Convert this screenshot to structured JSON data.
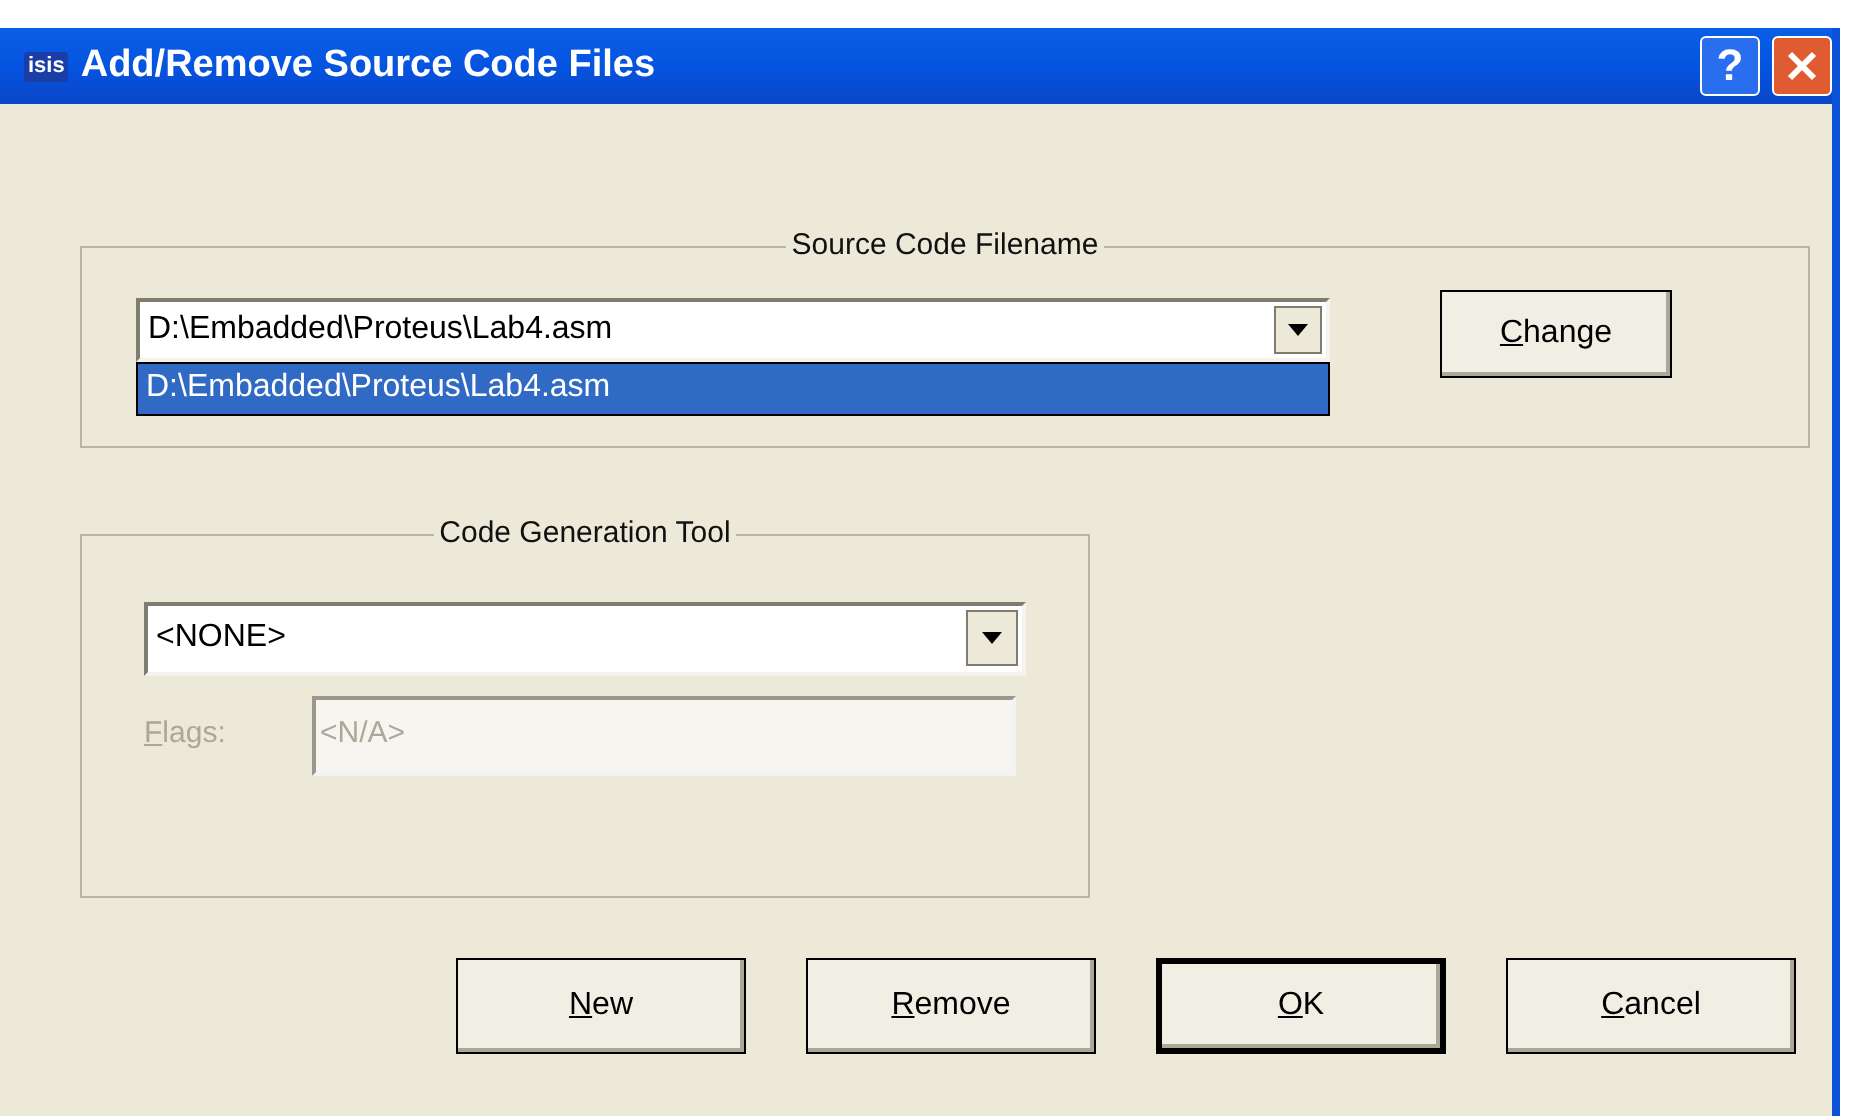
{
  "window": {
    "app_icon": "isis",
    "title": "Add/Remove Source Code Files",
    "help_button": "?"
  },
  "source_group": {
    "legend": "Source Code Filename",
    "combo": {
      "value": "D:\\Embadded\\Proteus\\Lab4.asm",
      "options": [
        {
          "label": "D:\\Embadded\\Proteus\\Lab4.asm",
          "selected": true
        }
      ]
    },
    "change_button": {
      "label": "Change",
      "underline_first": true
    }
  },
  "tool_group": {
    "legend": "Code Generation Tool",
    "combo": {
      "value": "<NONE>"
    },
    "flags": {
      "label": "Flags:",
      "underline_first": true,
      "value": "<N/A>",
      "disabled": true
    }
  },
  "buttons": [
    {
      "label": "New",
      "underline_first": true,
      "default": false
    },
    {
      "label": "Remove",
      "underline_first": true,
      "default": false
    },
    {
      "label": "OK",
      "underline_first": true,
      "default": true
    },
    {
      "label": "Cancel",
      "underline_first": true,
      "default": false
    }
  ]
}
